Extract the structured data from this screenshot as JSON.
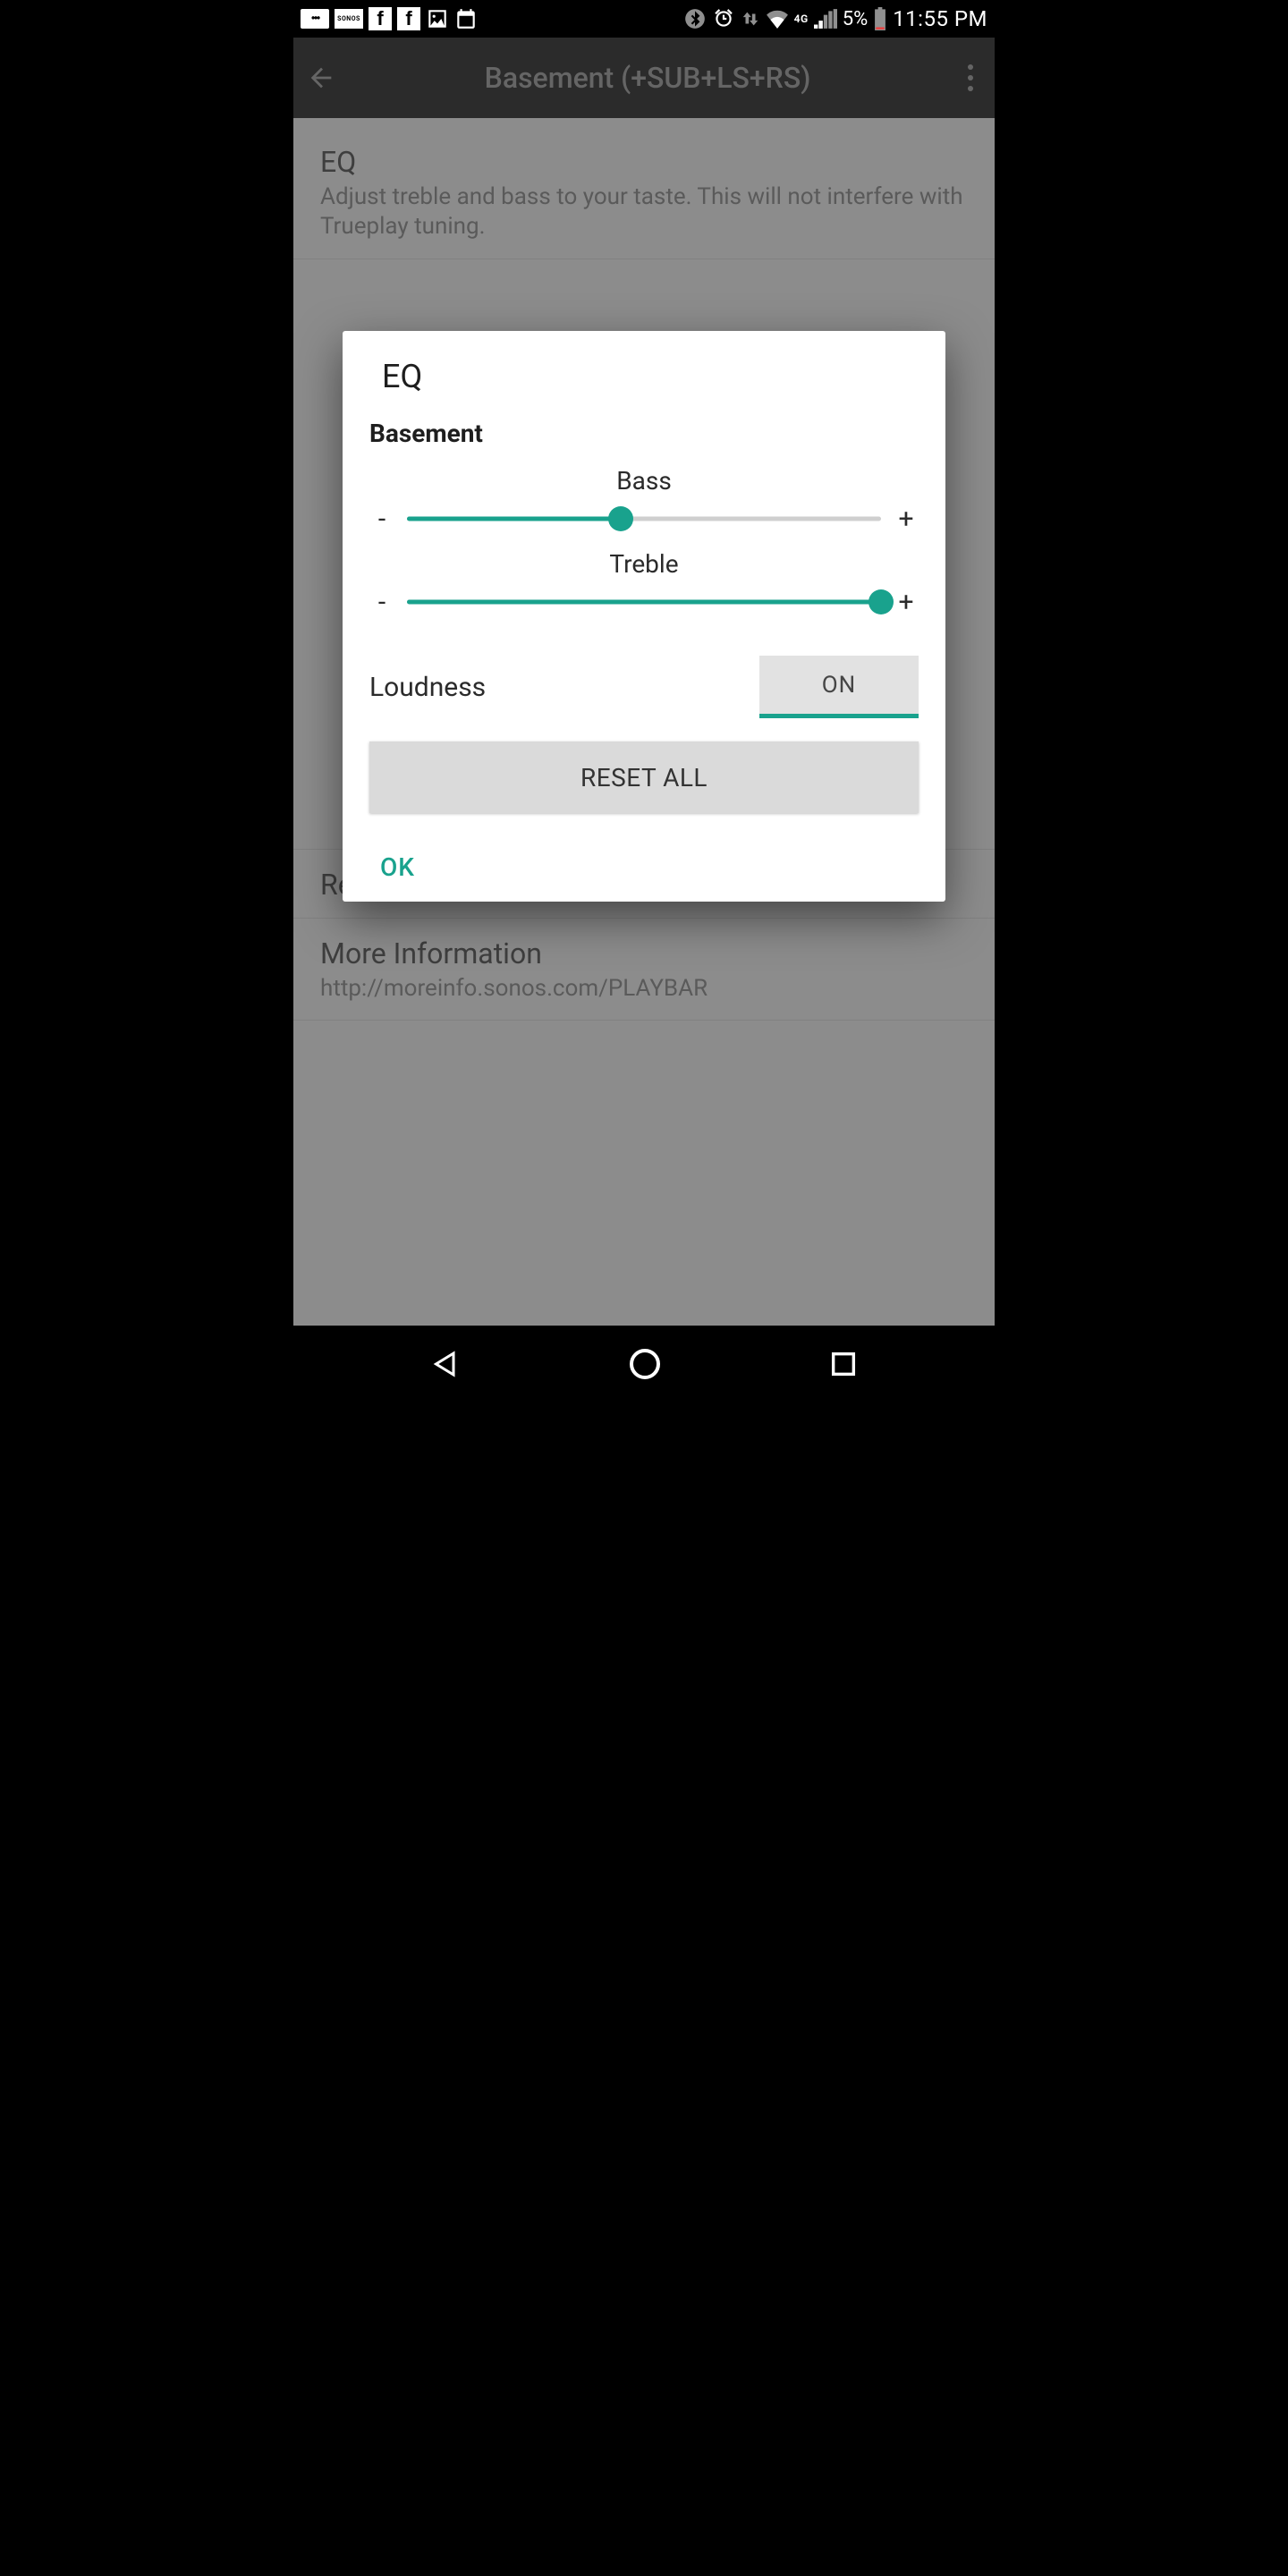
{
  "status": {
    "network_label": "4G",
    "battery_percent": "5%",
    "clock": "11:55 PM"
  },
  "app_bar": {
    "title": "Basement (+SUB+LS+RS)"
  },
  "bg": {
    "eq_title": "EQ",
    "eq_sub": "Adjust treble and bass to your taste. This will not interfere with Trueplay tuning.",
    "remove_surrounds": "Remove Surrounds",
    "more_info": "More Information",
    "more_info_url": "http://moreinfo.sonos.com/PLAYBAR"
  },
  "dialog": {
    "title": "EQ",
    "room": "Basement",
    "bass_label": "Bass",
    "bass_value": 45,
    "treble_label": "Treble",
    "treble_value": 100,
    "minus": "-",
    "plus": "+",
    "loudness_label": "Loudness",
    "loudness_value": "ON",
    "reset_label": "RESET ALL",
    "ok_label": "OK"
  }
}
